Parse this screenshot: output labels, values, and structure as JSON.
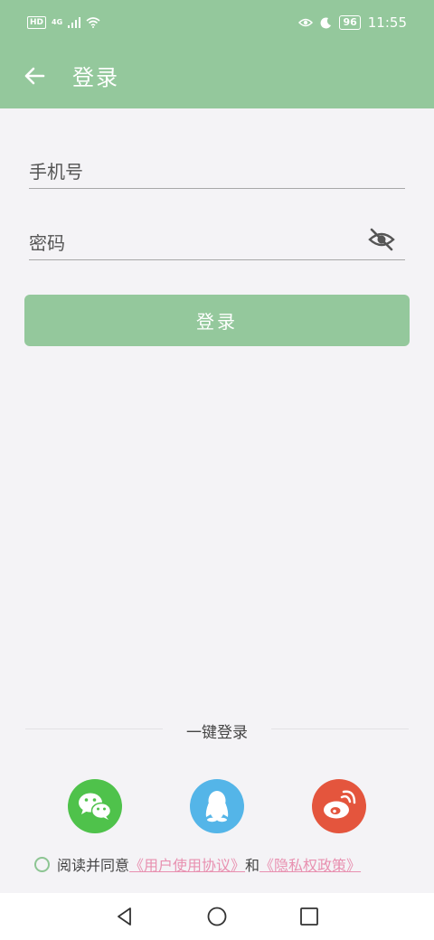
{
  "status_bar": {
    "hd": "HD",
    "network": "4G",
    "battery": "96",
    "time": "11:55"
  },
  "header": {
    "title": "登录"
  },
  "form": {
    "phone_placeholder": "手机号",
    "password_placeholder": "密码",
    "login_button": "登录"
  },
  "quick_login": {
    "label": "一键登录",
    "options": [
      {
        "name": "wechat",
        "color": "#4fc24b"
      },
      {
        "name": "qq",
        "color": "#54b5e8"
      },
      {
        "name": "weibo",
        "color": "#e4553d"
      }
    ]
  },
  "agreement": {
    "prefix": "阅读并同意",
    "user_agreement": "《用户使用协议》",
    "conjunction": "和",
    "privacy_policy": "《隐私权政策》"
  },
  "colors": {
    "accent": "#94c89c",
    "link": "#e890b0",
    "background": "#f4f3f6"
  }
}
